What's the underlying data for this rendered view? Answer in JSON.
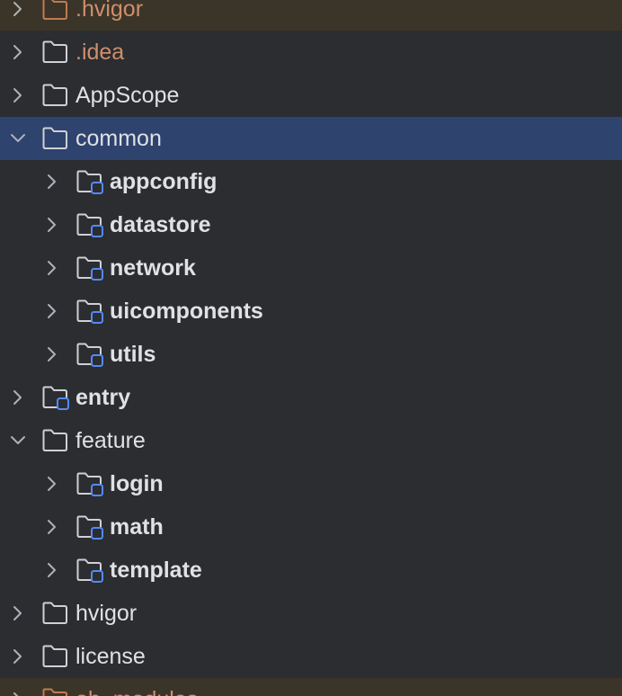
{
  "colors": {
    "text": "#dfe1e5",
    "excluded_text": "#cf8e6d",
    "folder_stroke": "#ced0d6",
    "excluded_folder_stroke": "#c27a50",
    "module_marker": "#548af7",
    "selected_row": "#2e436e",
    "excluded_row": "#3a3528",
    "background": "#2b2d30"
  },
  "project_tree": {
    "items": [
      {
        "label": ".hvigor",
        "depth": 0,
        "expanded": false,
        "kind": "excluded",
        "selected": false
      },
      {
        "label": ".idea",
        "depth": 0,
        "expanded": false,
        "kind": "folder-orange-text",
        "selected": false
      },
      {
        "label": "AppScope",
        "depth": 0,
        "expanded": false,
        "kind": "folder",
        "selected": false
      },
      {
        "label": "common",
        "depth": 0,
        "expanded": true,
        "kind": "folder",
        "selected": true
      },
      {
        "label": "appconfig",
        "depth": 1,
        "expanded": false,
        "kind": "module",
        "selected": false
      },
      {
        "label": "datastore",
        "depth": 1,
        "expanded": false,
        "kind": "module",
        "selected": false
      },
      {
        "label": "network",
        "depth": 1,
        "expanded": false,
        "kind": "module",
        "selected": false
      },
      {
        "label": "uicomponents",
        "depth": 1,
        "expanded": false,
        "kind": "module",
        "selected": false
      },
      {
        "label": "utils",
        "depth": 1,
        "expanded": false,
        "kind": "module",
        "selected": false
      },
      {
        "label": "entry",
        "depth": 0,
        "expanded": false,
        "kind": "module",
        "selected": false
      },
      {
        "label": "feature",
        "depth": 0,
        "expanded": true,
        "kind": "folder",
        "selected": false
      },
      {
        "label": "login",
        "depth": 1,
        "expanded": false,
        "kind": "module",
        "selected": false
      },
      {
        "label": "math",
        "depth": 1,
        "expanded": false,
        "kind": "module",
        "selected": false
      },
      {
        "label": "template",
        "depth": 1,
        "expanded": false,
        "kind": "module",
        "selected": false
      },
      {
        "label": "hvigor",
        "depth": 0,
        "expanded": false,
        "kind": "folder",
        "selected": false
      },
      {
        "label": "license",
        "depth": 0,
        "expanded": false,
        "kind": "folder",
        "selected": false
      },
      {
        "label": "oh_modules",
        "depth": 0,
        "expanded": false,
        "kind": "excluded",
        "selected": false
      }
    ]
  }
}
